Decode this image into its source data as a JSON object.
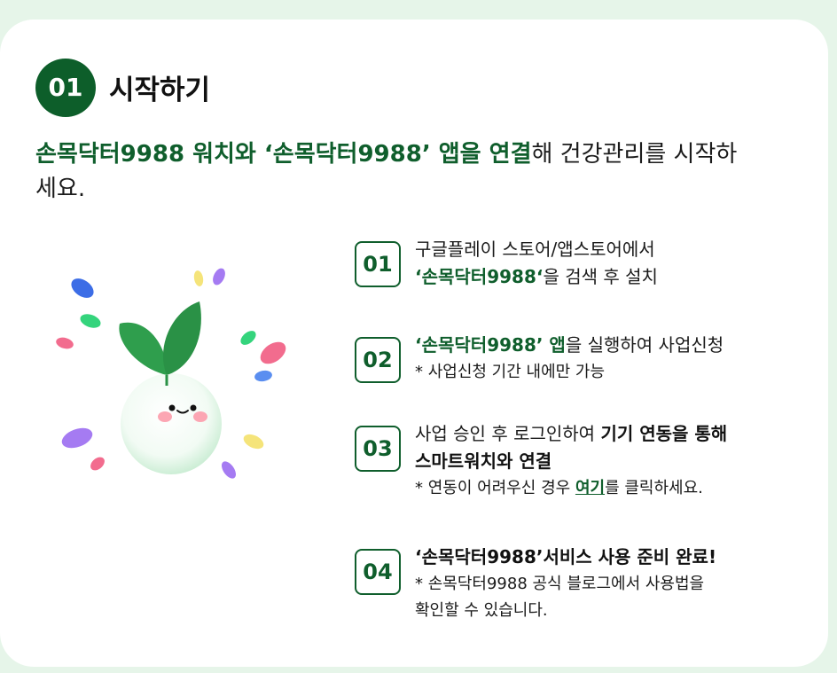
{
  "header": {
    "badge": "01",
    "title": "시작하기"
  },
  "intro": {
    "highlight1": "손목닥터9988 워치와 ‘손목닥터9988’ 앱을 연결",
    "rest1": "해 건강관리를 시작하",
    "line2": "세요."
  },
  "steps": [
    {
      "number": "01",
      "line1": "구글플레이 스토어/앱스토어에서",
      "line2_green": "‘손목닥터9988‘",
      "line2_rest": "을 검색 후 설치"
    },
    {
      "number": "02",
      "line1_green": "‘손목닥터9988’ 앱",
      "line1_rest": "을 실행하여 사업신청",
      "note": "* 사업신청 기간 내에만 가능"
    },
    {
      "number": "03",
      "line1_plain": "사업 승인 후 로그인하여 ",
      "line1_bold": "기기 연동을 통해",
      "line2_bold": "스마트워치와 연결",
      "note_pre": "* 연동이 어려우신 경우 ",
      "note_link": "여기",
      "note_post": "를 클릭하세요."
    },
    {
      "number": "04",
      "title": "‘손목닥터9988’서비스 사용 준비 완료!",
      "note1": "* 손목닥터9988 공식 블로그에서 사용법을",
      "note2": "확인할 수 있습니다."
    }
  ],
  "colors": {
    "brand_green": "#0f5e2c",
    "badge_green": "#0d5e2a",
    "page_bg": "#e6f5e9"
  },
  "illustration": {
    "icon": "sprout-character-icon"
  }
}
